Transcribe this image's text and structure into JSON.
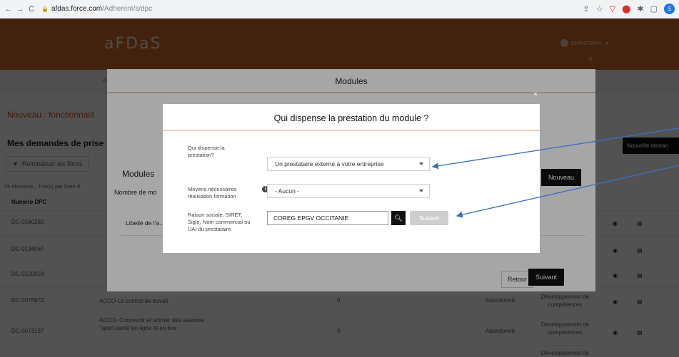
{
  "browser": {
    "url_host": "afdas.force.com",
    "url_path": "/Adherent/s/dpc",
    "profile_initial": "S"
  },
  "site": {
    "logo": "aFDaS",
    "user_name": "CHRISTOPH... ▾",
    "title": "Nouveau : fonctionnalit",
    "section_heading": "Mes demandes de prise",
    "reset_filters": "Réinitialiser les filtres",
    "count_text": "25 éléments - Trié(s) par Date d",
    "column_header": "Numéro DPC",
    "new_request_button": "Nouvelle deman",
    "rows": [
      {
        "id": "DC-0160262"
      },
      {
        "id": "DC-0134067"
      },
      {
        "id": "DC-0120818"
      },
      {
        "id": "DC-0076972",
        "libelle": "ACCO-Le contrat de travail",
        "number": "0",
        "status": "Abandonné",
        "type": "Développement de compétences"
      },
      {
        "id": "DC-0073197",
        "libelle": "ACCO- Concevoir et animer des séances \"sport santé\"en ligne et en live",
        "number": "0",
        "status": "Abandonné",
        "type": "Développement de compétences"
      },
      {
        "type": "Développement de"
      }
    ]
  },
  "modal_modules": {
    "title": "Modules",
    "modules_heading": "Modules",
    "nb_label": "Nombre de mo",
    "lib_label": "Libellé de l'a...",
    "new_button": "Nouveau",
    "back_button": "Retour",
    "next_button": "Suivant"
  },
  "modal_provider": {
    "title": "Qui dispense la prestation du module ?",
    "q1_label": "Qui dispense la prestation?",
    "q1_value": "Un prestataire externe à votre entreprise",
    "q2_label": "Moyens nécessaires réalisation formation",
    "q2_value": "- Aucun -",
    "q3_label": "Raison sociale, SIRET, Sigle, Nom commercial ou UAI du prestataire",
    "q3_value": "COREG EPGV OCCITANIE",
    "next_button": "Suivant"
  },
  "colors": {
    "brand_orange": "#cf6b2a",
    "annotation_arrow": "#3a6fc4"
  }
}
